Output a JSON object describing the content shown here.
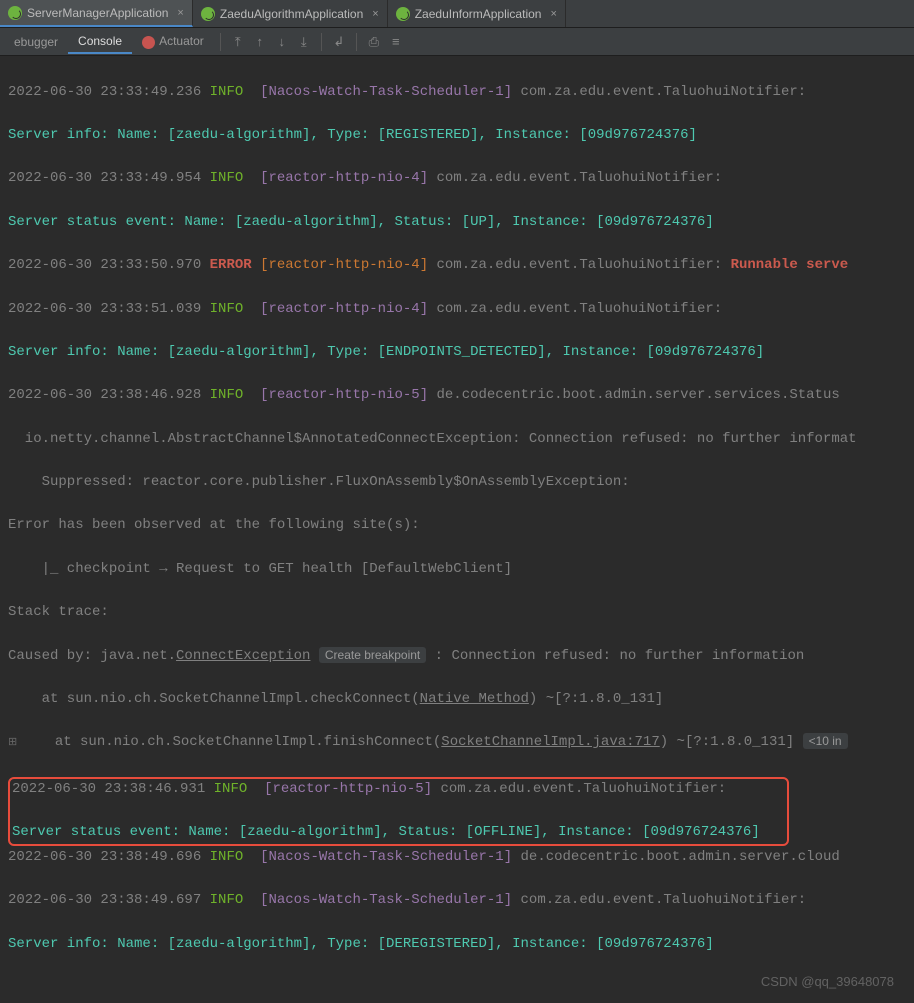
{
  "tabs": [
    {
      "label": "ServerManagerApplication"
    },
    {
      "label": "ZaeduAlgorithmApplication"
    },
    {
      "label": "ZaeduInformApplication"
    }
  ],
  "toolrow": {
    "debugger": "ebugger",
    "console": "Console",
    "actuator": "Actuator"
  },
  "log": {
    "l1_ts": "2022-06-30 23:33:49.236",
    "l1_lvl": "INFO",
    "l1_thr": "[Nacos-Watch-Task-Scheduler-1]",
    "l1_log": "com.za.edu.event.TaluohuiNotifier:",
    "l2": "Server info: Name: [zaedu-algorithm], Type: [REGISTERED], Instance: [09d976724376]",
    "l3_ts": "2022-06-30 23:33:49.954",
    "l3_lvl": "INFO",
    "l3_thr": "[reactor-http-nio-4]",
    "l3_log": "com.za.edu.event.TaluohuiNotifier:",
    "l4": "Server status event: Name: [zaedu-algorithm], Status: [UP], Instance: [09d976724376]",
    "l5_ts": "2022-06-30 23:33:50.970",
    "l5_lvl": "ERROR",
    "l5_thr": "[reactor-http-nio-4]",
    "l5_log": "com.za.edu.event.TaluohuiNotifier:",
    "l5_tail": "Runnable serve",
    "l6_ts": "2022-06-30 23:33:51.039",
    "l6_lvl": "INFO",
    "l6_thr": "[reactor-http-nio-4]",
    "l6_log": "com.za.edu.event.TaluohuiNotifier:",
    "l7": "Server info: Name: [zaedu-algorithm], Type: [ENDPOINTS_DETECTED], Instance: [09d976724376]",
    "l8_ts": "2022-06-30 23:38:46.928",
    "l8_lvl": "INFO",
    "l8_thr": "[reactor-http-nio-5]",
    "l8_log": "de.codecentric.boot.admin.server.services.Status",
    "l9": "  io.netty.channel.AbstractChannel$AnnotatedConnectException: Connection refused: no further informat",
    "l10": "    Suppressed: reactor.core.publisher.FluxOnAssembly$OnAssemblyException:",
    "l11": "Error has been observed at the following site(s):",
    "l12": "    |_ checkpoint → Request to GET health [DefaultWebClient]",
    "l13": "Stack trace:",
    "l14a": "Caused by: java.net.",
    "l14b": "ConnectException",
    "l14hint": "Create breakpoint",
    "l14c": ": Connection refused: no further information",
    "l15a": "    at sun.nio.ch.SocketChannelImpl.checkConnect(",
    "l15b": "Native Method",
    "l15c": ") ~[?:1.8.0_131]",
    "l16a": "    at sun.nio.ch.SocketChannelImpl.finishConnect(",
    "l16b": "SocketChannelImpl.java:717",
    "l16c": ") ~[?:1.8.0_131]",
    "l16fold": "<10 in",
    "l17_ts": "2022-06-30 23:38:46.931",
    "l17_lvl": "INFO",
    "l17_thr": "[reactor-http-nio-5]",
    "l17_log": "com.za.edu.event.TaluohuiNotifier:",
    "l18": "Server status event: Name: [zaedu-algorithm], Status: [OFFLINE], Instance: [09d976724376]",
    "l19_ts": "2022-06-30 23:38:49.696",
    "l19_lvl": "INFO",
    "l19_thr": "[Nacos-Watch-Task-Scheduler-1]",
    "l19_log": "de.codecentric.boot.admin.server.cloud",
    "l20_ts": "2022-06-30 23:38:49.697",
    "l20_lvl": "INFO",
    "l20_thr": "[Nacos-Watch-Task-Scheduler-1]",
    "l20_log": "com.za.edu.event.TaluohuiNotifier:",
    "l21": "Server info: Name: [zaedu-algorithm], Type: [DEREGISTERED], Instance: [09d976724376]"
  },
  "watermark": "CSDN @qq_39648078"
}
